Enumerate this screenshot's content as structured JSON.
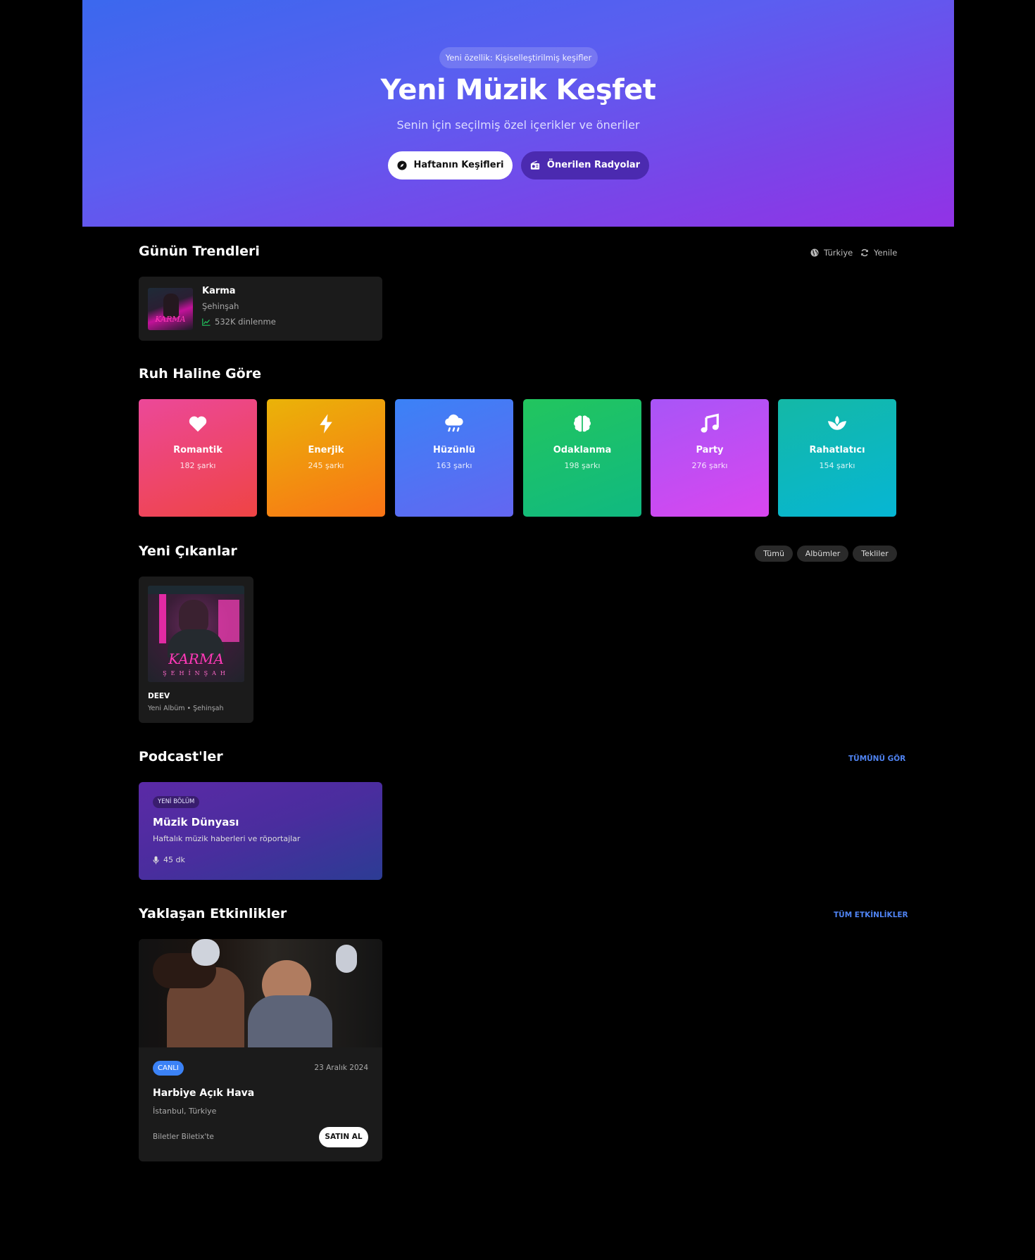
{
  "hero": {
    "badge": "Yeni özellik: Kişiselleştirilmiş keşifler",
    "title": "Yeni Müzik Keşfet",
    "subtitle": "Senin için seçilmiş özel içerikler ve öneriler",
    "primary_button": "Haftanın Keşifleri",
    "secondary_button": "Önerilen Radyolar"
  },
  "trends": {
    "title": "Günün Trendleri",
    "region": "Türkiye",
    "refresh": "Yenile",
    "items": [
      {
        "title": "Karma",
        "artist": "Şehinşah",
        "plays": "532K dinlenme",
        "cover_text": "KARMA"
      }
    ]
  },
  "moods": {
    "title": "Ruh Haline Göre",
    "items": [
      {
        "name": "Romantik",
        "count": "182 şarkı",
        "icon": "heart-icon",
        "colors": [
          "#ec4899",
          "#ef4444"
        ]
      },
      {
        "name": "Enerjik",
        "count": "245 şarkı",
        "icon": "bolt-icon",
        "colors": [
          "#eab308",
          "#f97316"
        ]
      },
      {
        "name": "Hüzünlü",
        "count": "163 şarkı",
        "icon": "cloud-rain-icon",
        "colors": [
          "#3b82f6",
          "#6366f1"
        ]
      },
      {
        "name": "Odaklanma",
        "count": "198 şarkı",
        "icon": "brain-icon",
        "colors": [
          "#22c55e",
          "#10b981"
        ]
      },
      {
        "name": "Party",
        "count": "276 şarkı",
        "icon": "music-icon",
        "colors": [
          "#a855f7",
          "#d946ef"
        ]
      },
      {
        "name": "Rahatlatıcı",
        "count": "154 şarkı",
        "icon": "spa-icon",
        "colors": [
          "#14b8a6",
          "#06b6d4"
        ]
      }
    ]
  },
  "releases": {
    "title": "Yeni Çıkanlar",
    "filters": [
      "Tümü",
      "Albümler",
      "Tekliler"
    ],
    "items": [
      {
        "title": "DEEV",
        "meta": "Yeni Albüm • Şehinşah",
        "cover_text": "KARMA",
        "cover_sub": "ŞEHİNŞAH"
      }
    ]
  },
  "podcasts": {
    "title": "Podcast'ler",
    "see_all": "TÜMÜNÜ GÖR",
    "items": [
      {
        "badge": "YENİ BÖLÜM",
        "title": "Müzik Dünyası",
        "desc": "Haftalık müzik haberleri ve röportajlar",
        "duration": "45 dk"
      }
    ]
  },
  "events": {
    "title": "Yaklaşan Etkinlikler",
    "see_all": "TÜM ETKİNLİKLER",
    "items": [
      {
        "tag": "CANLI",
        "date": "23 Aralık 2024",
        "title": "Harbiye Açık Hava",
        "location": "İstanbul, Türkiye",
        "tickets": "Biletler Biletix'te",
        "buy": "SATIN AL"
      }
    ]
  }
}
